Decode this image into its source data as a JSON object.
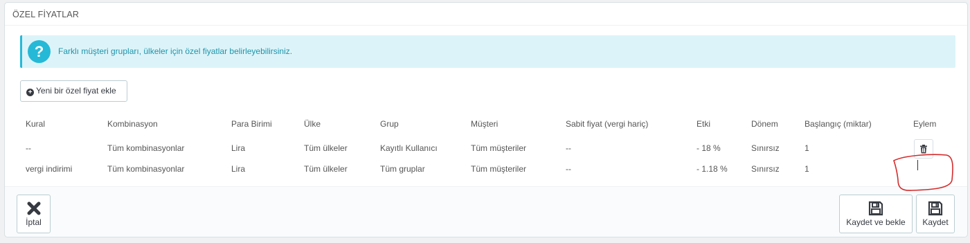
{
  "panel": {
    "title": "ÖZEL FİYATLAR"
  },
  "alert": {
    "icon": "question-icon",
    "text": "Farklı müşteri grupları, ülkeler için özel fiyatlar belirleyebilirsiniz."
  },
  "add_button": {
    "icon": "plus-circle-icon",
    "label": "Yeni bir özel fiyat ekle"
  },
  "table": {
    "headers": [
      "Kural",
      "Kombinasyon",
      "Para Birimi",
      "Ülke",
      "Grup",
      "Müşteri",
      "Sabit fiyat (vergi hariç)",
      "Etki",
      "Dönem",
      "Başlangıç (miktar)",
      "Eylem"
    ],
    "rows": [
      [
        "--",
        "Tüm kombinasyonlar",
        "Lira",
        "Tüm ülkeler",
        "Kayıtlı Kullanıcı",
        "Tüm müşteriler",
        "--",
        "- 18 %",
        "Sınırsız",
        "1"
      ],
      [
        "vergi indirimi",
        "Tüm kombinasyonlar",
        "Lira",
        "Tüm ülkeler",
        "Tüm gruplar",
        "Tüm müşteriler",
        "--",
        "- 1.18 %",
        "Sınırsız",
        "1"
      ]
    ],
    "row_actions": [
      "trash-icon",
      ""
    ]
  },
  "footer": {
    "cancel_label": "İptal",
    "save_stay_label": "Kaydet ve bekle",
    "save_label": "Kaydet"
  },
  "colors": {
    "accent": "#25b9d7",
    "alert_bg": "#dcf4f9",
    "annotation": "#d42b2b"
  }
}
